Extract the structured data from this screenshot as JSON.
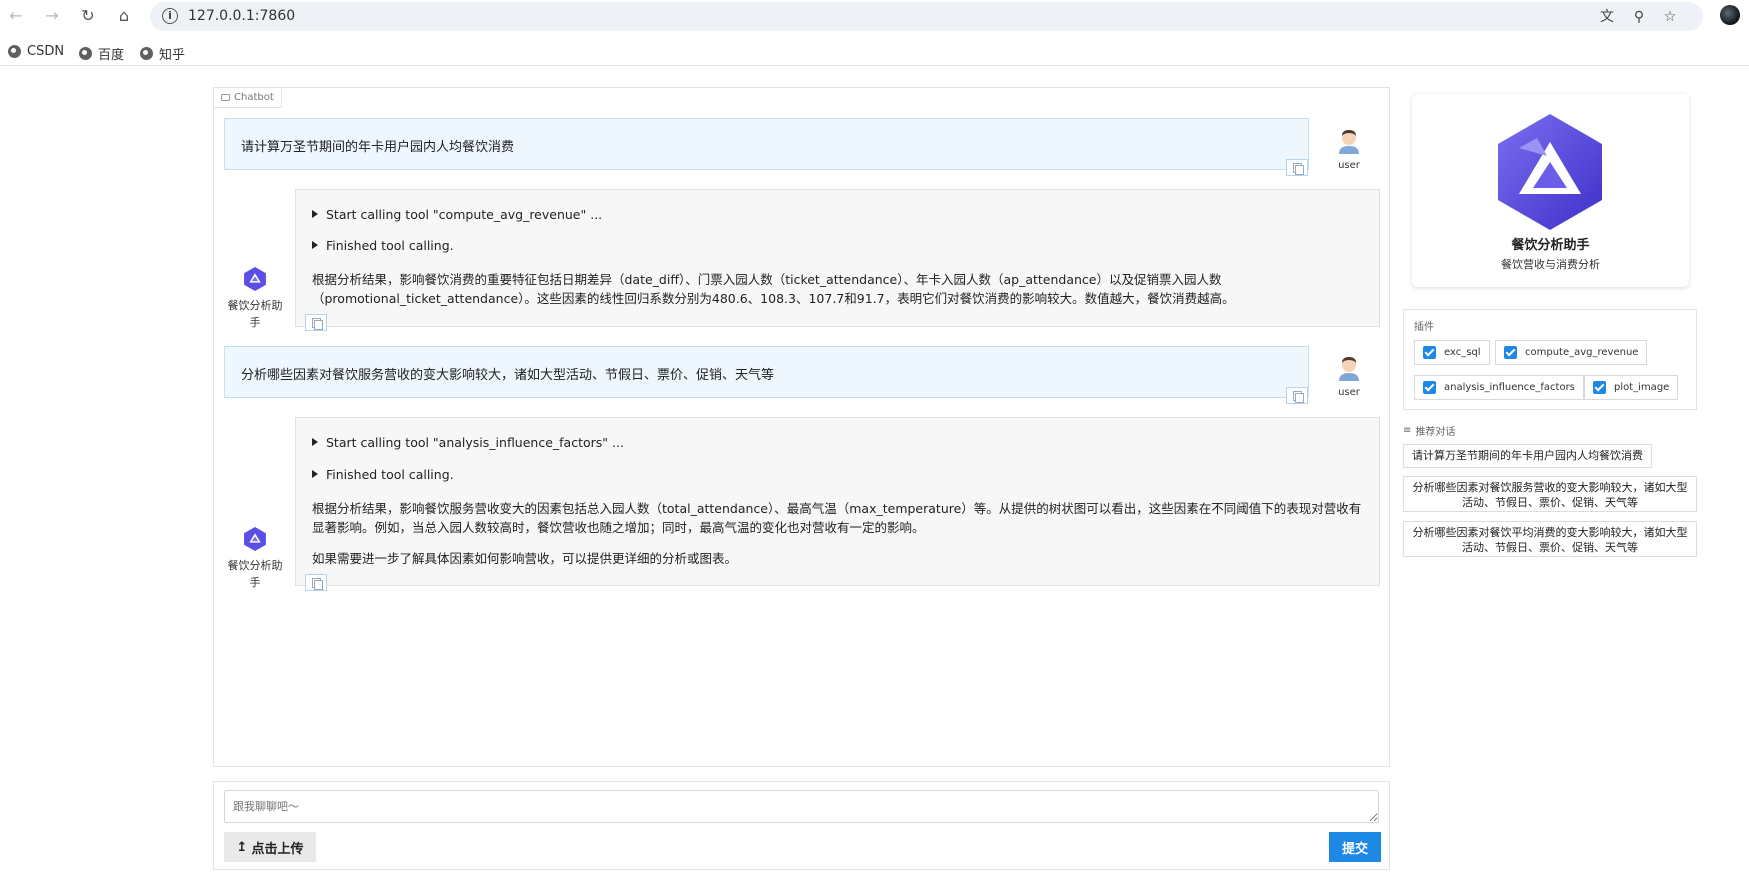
{
  "browser": {
    "url": "127.0.0.1:7860",
    "bookmarks": [
      "CSDN",
      "百度",
      "知乎"
    ]
  },
  "chat": {
    "label": "Chatbot",
    "user_name": "user",
    "bot_name": "餐饮分析助手",
    "messages": [
      {
        "role": "user",
        "text": "请计算万圣节期间的年卡用户园内人均餐饮消费"
      },
      {
        "role": "bot",
        "tool_call": "Start calling tool \"compute_avg_revenue\" ...",
        "tool_done": "Finished tool calling.",
        "paragraphs": [
          "根据分析结果，影响餐饮消费的重要特征包括日期差异（date_diff）、门票入园人数（ticket_attendance）、年卡入园人数（ap_attendance）以及促销票入园人数（promotional_ticket_attendance）。这些因素的线性回归系数分别为480.6、108.3、107.7和91.7，表明它们对餐饮消费的影响较大。数值越大，餐饮消费越高。"
        ]
      },
      {
        "role": "user",
        "text": "分析哪些因素对餐饮服务营收的变大影响较大，诸如大型活动、节假日、票价、促销、天气等"
      },
      {
        "role": "bot",
        "tool_call": "Start calling tool \"analysis_influence_factors\" ...",
        "tool_done": "Finished tool calling.",
        "paragraphs": [
          "根据分析结果，影响餐饮服务营收变大的因素包括总入园人数（total_attendance）、最高气温（max_temperature）等。从提供的树状图可以看出，这些因素在不同阈值下的表现对营收有显著影响。例如，当总入园人数较高时，餐饮营收也随之增加；同时，最高气温的变化也对营收有一定的影响。",
          "如果需要进一步了解具体因素如何影响营收，可以提供更详细的分析或图表。"
        ]
      }
    ]
  },
  "input": {
    "placeholder": "跟我聊聊吧～",
    "upload_label": "点击上传",
    "submit_label": "提交"
  },
  "agent": {
    "name": "餐饮分析助手",
    "description": "餐饮营收与消费分析",
    "brand_color": "#5b4ee6"
  },
  "plugins": {
    "title": "插件",
    "items": [
      {
        "name": "exc_sql",
        "checked": true
      },
      {
        "name": "compute_avg_revenue",
        "checked": true
      },
      {
        "name": "analysis_influence_factors",
        "checked": true
      },
      {
        "name": "plot_image",
        "checked": true
      }
    ]
  },
  "suggestions": {
    "title": "推荐对话",
    "items": [
      "请计算万圣节期间的年卡用户园内人均餐饮消费",
      "分析哪些因素对餐饮服务营收的变大影响较大，诸如大型活动、节假日、票价、促销、天气等",
      "分析哪些因素对餐饮平均消费的变大影响较大，诸如大型活动、节假日、票价、促销、天气等"
    ]
  },
  "colors": {
    "accent": "#1e88e5",
    "user_bubble": "#eef6fe",
    "bot_bubble": "#f7f7f7"
  }
}
